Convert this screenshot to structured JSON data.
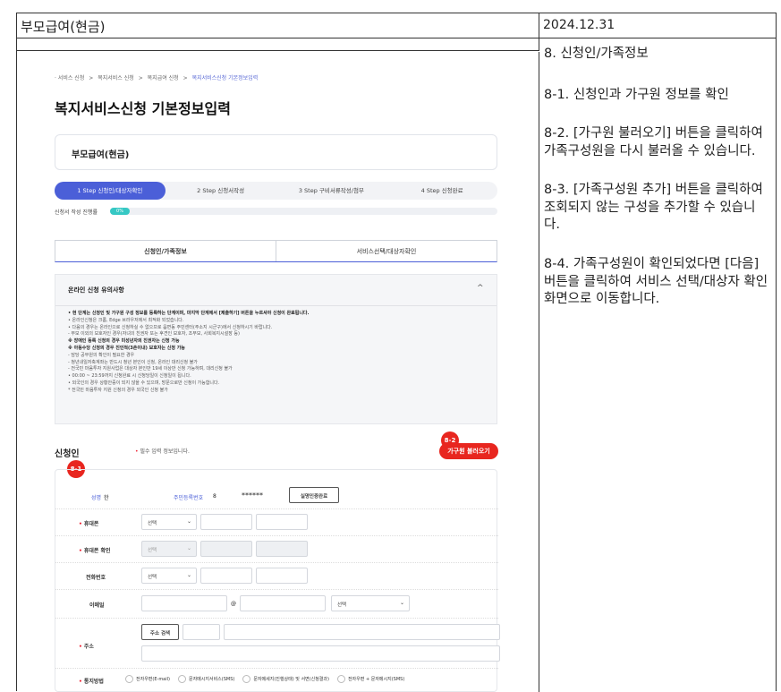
{
  "header": {
    "title": "부모급여(현금)",
    "date": "2024.12.31"
  },
  "instructions": {
    "section": "8. 신청인/가족정보",
    "p1": "8-1. 신청인과 가구원 정보를 확인",
    "p2": "8-2. [가구원 불러오기] 버튼을 클릭하여 가족구성원을 다시 불러올 수 있습니다.",
    "p3": "8-3. [가족구성원 추가] 버튼을 클릭하여 조회되지 않는 구성을 추가할 수 있습니다.",
    "p4": "8-4. 가족구성원이 확인되었다면 [다음] 버튼을 클릭하여 서비스 선택/대상자 확인 화면으로 이동합니다."
  },
  "screen": {
    "breadcrumb": {
      "items": [
        "서비스 신청",
        "복지서비스 신청",
        "복지급여 신청"
      ],
      "current": "복지서비스신청 기본정보입력",
      "sep": ">"
    },
    "page_title": "복지서비스신청 기본정보입력",
    "service_name": "부모급여(현금)",
    "steps": [
      "1 Step 신청인/대상자확인",
      "2 Step 신청서작성",
      "3 Step 구비서류작성/첨부",
      "4 Step 신청완료"
    ],
    "progress": {
      "label": "신청서 작성 진행률",
      "value_text": "0%",
      "value": 0
    },
    "tabs": [
      "신청인/가족정보",
      "서비스선택/대상자확인"
    ],
    "notice": {
      "title": "온라인 신청 유의사항",
      "toggle": "^",
      "lines": [
        "• 현 단계는 신청인 및 가구원 구성 정보를 등록하는 단계이며, 마지막 단계에서 [제출하기] 버튼을 누르셔야 신청이 완료됩니다.",
        "• 온라인신청은 크롬, Edge 브라우저에서 최적화 되었습니다.",
        "• 다음의 경우는 온라인으로 신청하실 수 없으므로 읍면동 주민센터(주소지 시군구)에서 신청하시기 바랍니다.",
        "  - 부모 이외의 보호자인 경우(자녀의 친권자 또는 후견인 보호자, 조부모, 사회복지시설장 등)",
        "    ※ 장애인 등록 신청의 경우 미성년자의 친권자는 신청 가능",
        "    ※ 아동수당 신청의 경우 친인척(3촌이내) 보호자는 신청 가능",
        "  - 담당 공무원의 확인이 필요한 경우",
        "  - 청년내일저축계좌는 반드시 청년 본인이 신청, 온라인 대리신청 불가",
        "  - 전국민 마음투자 지원사업은 대상자 본인만 19세 이상만 신청 가능하며, 대리신청 불가",
        "• 00:00 ~ 23:59까지 신청완료 시 신청당일이 신청일이 됩니다.",
        "• 외국인의 경우 상황안증이 되지 않을 수 있으며, 방문으로만 신청이 가능합니다.",
        "  * 전국민 마음투자 지원 신청의 경우 외국인 신청 불가"
      ]
    },
    "applicant": {
      "title": "신청인",
      "required_note": "필수 입력 정보입니다.",
      "required_mark": "•",
      "load_button": "가구원 불러오기"
    },
    "badges": {
      "b1": "8-1",
      "b2": "8-2"
    },
    "form": {
      "name_label": "성명",
      "name_value": "한",
      "rrn_label": "주민등록번호",
      "rrn_front": "8",
      "rrn_back": "******",
      "verify_button": "실명인증완료",
      "mobile_label": "휴대폰",
      "mobile_confirm_label": "휴대폰 확인",
      "phone_label": "전화번호",
      "email_label": "이메일",
      "email_at": "@",
      "address_label": "주소",
      "address_search": "주소 검색",
      "notify_label": "통지방법",
      "select_placeholder": "선택",
      "notify_options": [
        "전자우편(E-mail)",
        "문자메시지서비스(SMS)",
        "문자메세지(진행상태) 및 서면(신청결과)",
        "전자우편 + 문자메시지(SMS)"
      ]
    }
  }
}
